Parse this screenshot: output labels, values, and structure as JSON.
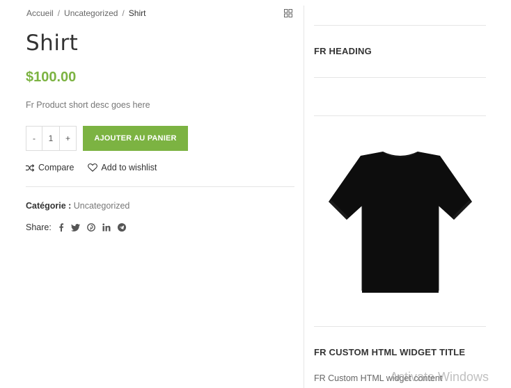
{
  "breadcrumb": {
    "home": "Accueil",
    "category": "Uncategorized",
    "current": "Shirt",
    "separator": "/"
  },
  "product": {
    "title": "Shirt",
    "price": "$100.00",
    "short_desc": "Fr Product short desc goes here",
    "quantity": {
      "minus": "-",
      "value": "1",
      "plus": "+"
    },
    "add_to_cart": "AJOUTER AU PANIER",
    "compare": "Compare",
    "wishlist": "Add to wishlist",
    "category_label": "Catégorie :",
    "category_value": "Uncategorized",
    "share_label": "Share:"
  },
  "share_icons": [
    "facebook-icon",
    "twitter-icon",
    "pinterest-icon",
    "linkedin-icon",
    "telegram-icon"
  ],
  "sidebar": {
    "heading": "FR HEADING",
    "custom_html_title": "FR CUSTOM HTML WIDGET TITLE",
    "custom_html_content": "FR Custom HTML widget content"
  },
  "watermark": "Activate Windows",
  "colors": {
    "accent": "#7cb342",
    "text": "#333333",
    "muted": "#777777",
    "divider": "#e5e5e5"
  }
}
